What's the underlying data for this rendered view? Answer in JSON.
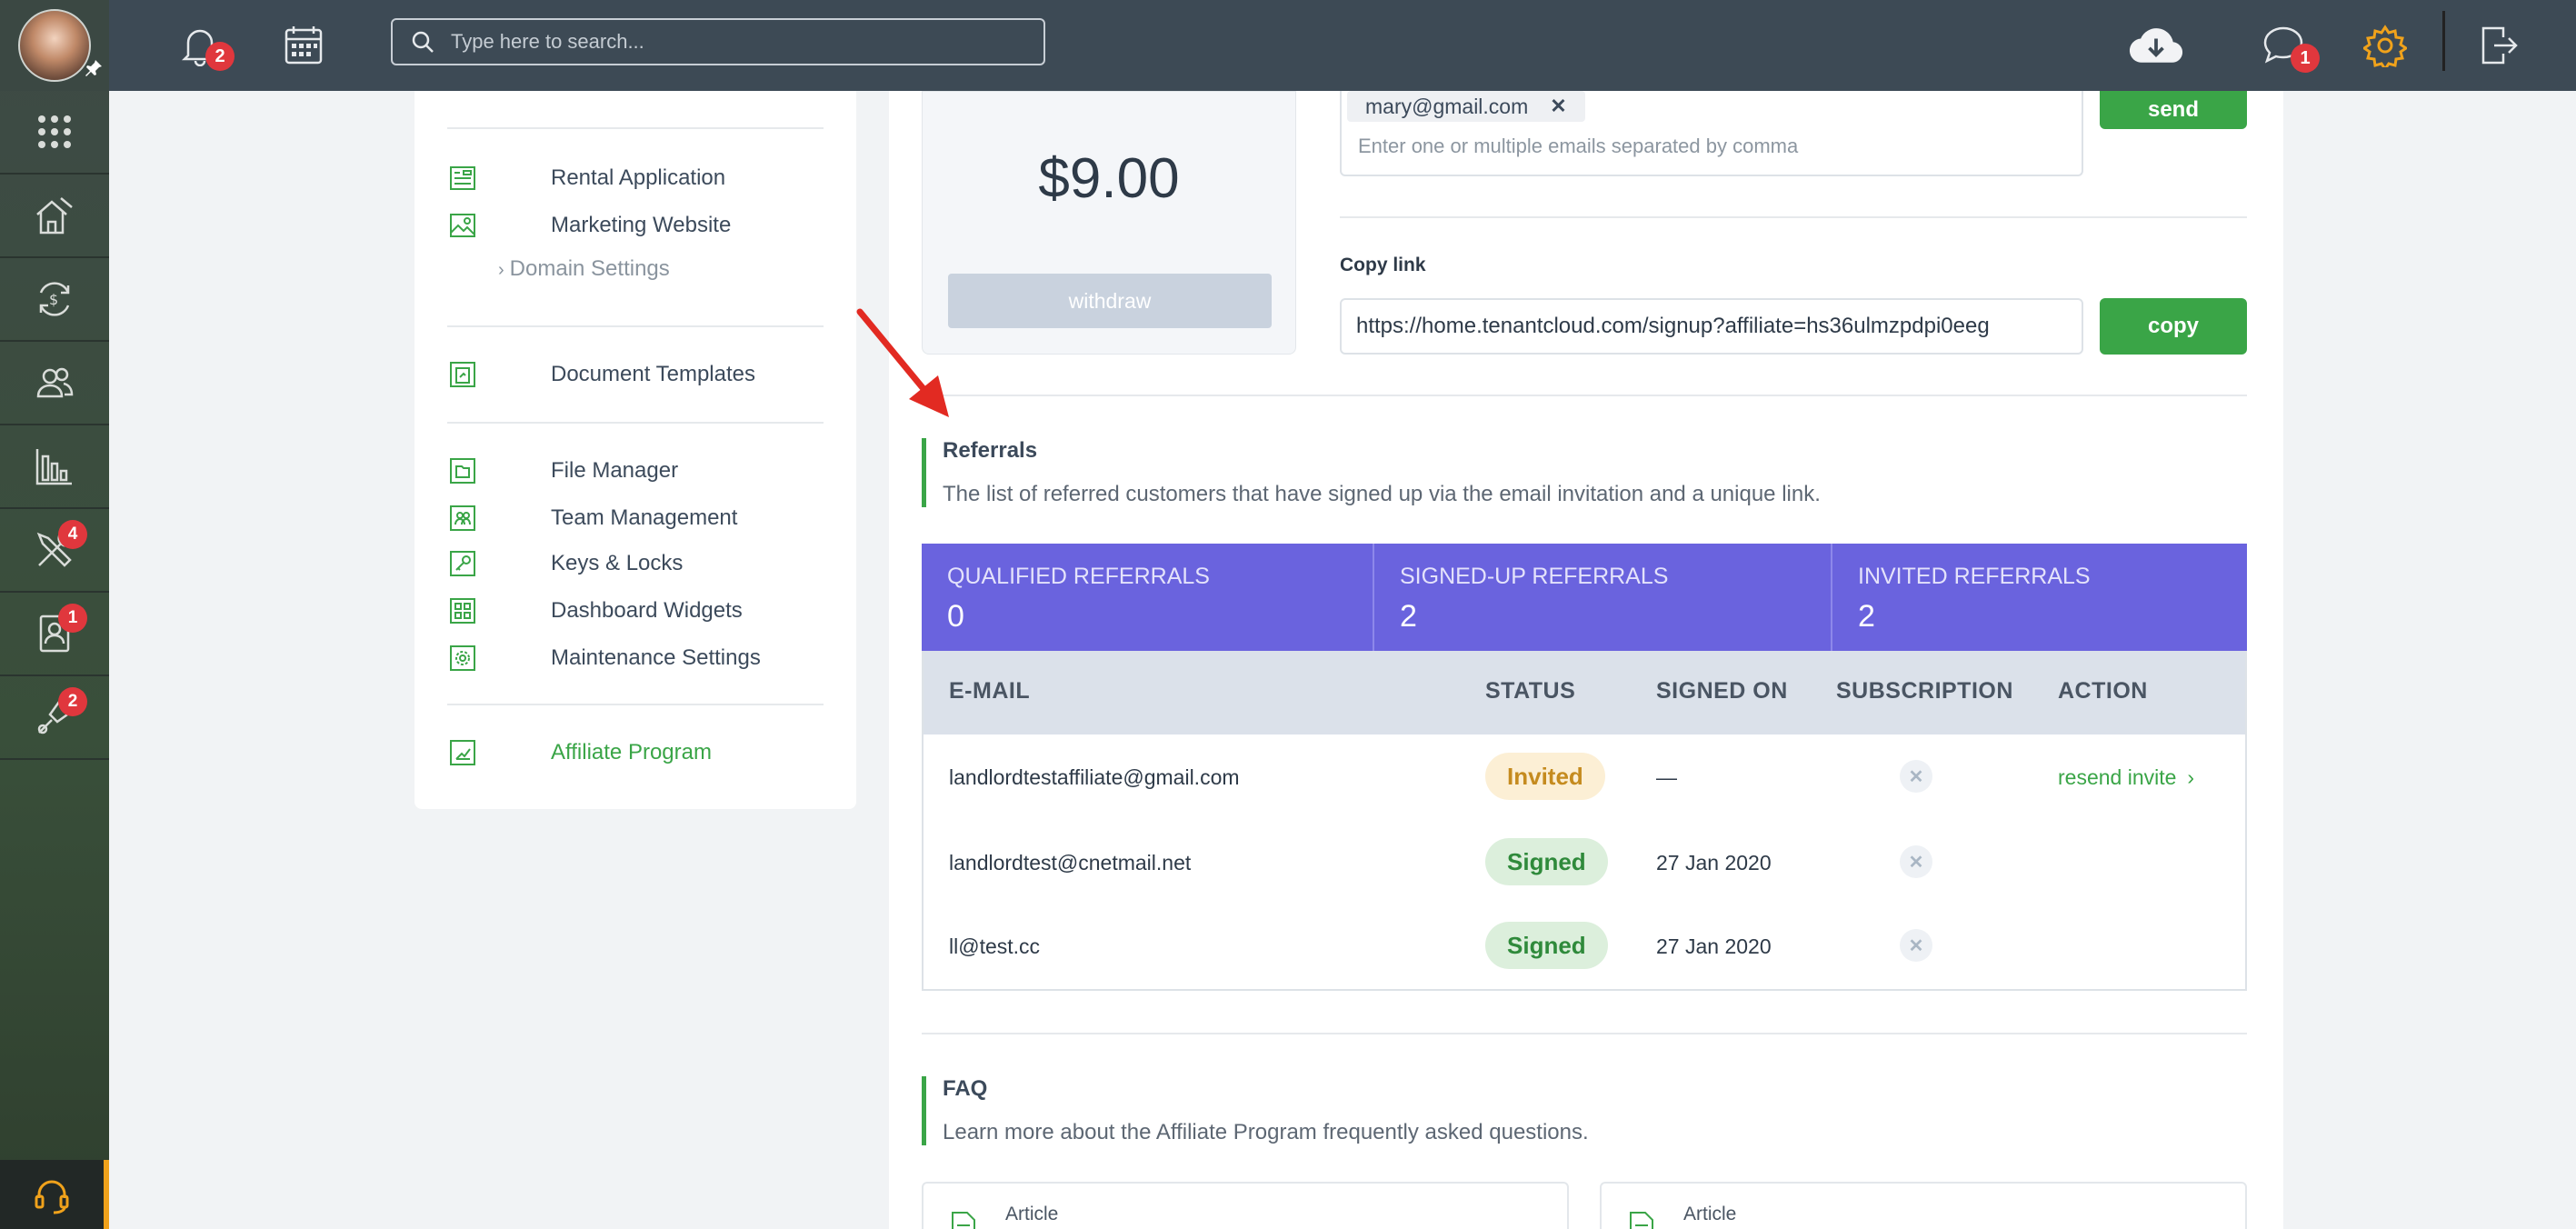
{
  "topbar": {
    "search_placeholder": "Type here to search...",
    "notifications_badge": "2",
    "messages_badge": "1"
  },
  "rail": {
    "badges": {
      "tools": "4",
      "tenants": "1",
      "listings": "2"
    }
  },
  "sidemenu": {
    "items": [
      {
        "label": "Rental Application"
      },
      {
        "label": "Marketing Website"
      },
      {
        "label": "Domain Settings"
      },
      {
        "label": "Document Templates"
      },
      {
        "label": "File Manager"
      },
      {
        "label": "Team Management"
      },
      {
        "label": "Keys & Locks"
      },
      {
        "label": "Dashboard Widgets"
      },
      {
        "label": "Maintenance Settings"
      },
      {
        "label": "Affiliate Program"
      }
    ]
  },
  "balance": {
    "amount": "$9.00",
    "withdraw_label": "withdraw"
  },
  "invite": {
    "chip_email": "mary@gmail.com",
    "placeholder": "Enter one or multiple emails separated by comma",
    "send_label": "send"
  },
  "copy_link": {
    "title": "Copy link",
    "url": "https://home.tenantcloud.com/signup?affiliate=hs36ulmzpdpi0eeg",
    "copy_label": "copy"
  },
  "referrals": {
    "title": "Referrals",
    "description": "The list of referred customers that have signed up via the email invitation and a unique link.",
    "stats": [
      {
        "label": "QUALIFIED REFERRALS",
        "value": "0"
      },
      {
        "label": "SIGNED-UP REFERRALS",
        "value": "2"
      },
      {
        "label": "INVITED REFERRALS",
        "value": "2"
      }
    ],
    "columns": [
      "E-MAIL",
      "STATUS",
      "SIGNED ON",
      "SUBSCRIPTION",
      "ACTION"
    ],
    "rows": [
      {
        "email": "landlordtestaffiliate@gmail.com",
        "status": "Invited",
        "signed_on": "—",
        "action": "resend invite"
      },
      {
        "email": "landlordtest@cnetmail.net",
        "status": "Signed",
        "signed_on": "27 Jan 2020",
        "action": ""
      },
      {
        "email": "ll@test.cc",
        "status": "Signed",
        "signed_on": "27 Jan 2020",
        "action": ""
      }
    ]
  },
  "faq": {
    "title": "FAQ",
    "description": "Learn more about the Affiliate Program frequently asked questions.",
    "articles": [
      {
        "label": "Article"
      },
      {
        "label": "Article"
      }
    ]
  },
  "colors": {
    "accent_green": "#3aa547",
    "stats_purple": "#6a63de",
    "topbar": "#3d4a55",
    "settings_orange": "#f0a21b",
    "annotation_arrow": "#e22a22"
  },
  "icons": {
    "topbar": [
      "bell-icon",
      "calendar-icon",
      "search-icon",
      "cloud-download-icon",
      "chat-icon",
      "gear-icon",
      "logout-icon"
    ],
    "rail": [
      "apps-grid-icon",
      "properties-icon",
      "payments-icon",
      "tenants-icon",
      "reports-icon",
      "tools-icon",
      "contacts-icon",
      "listings-icon",
      "support-headset-icon"
    ]
  }
}
